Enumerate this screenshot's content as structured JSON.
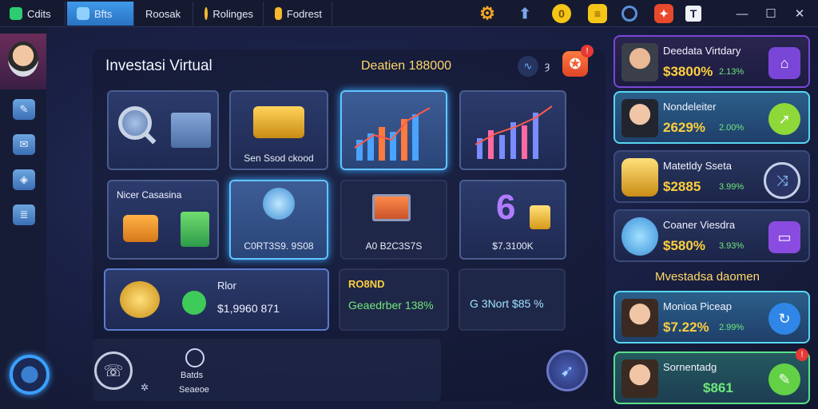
{
  "tabs": [
    {
      "label": "Cdits",
      "active": false
    },
    {
      "label": "Bfts",
      "active": true
    },
    {
      "label": "Roosak",
      "active": false
    },
    {
      "label": "Rolinges",
      "active": false
    },
    {
      "label": "Fodrest",
      "active": false
    }
  ],
  "toolbar_icons": [
    "gear-icon",
    "up-arrow-icon",
    "coin-icon",
    "note-icon",
    "ring-icon",
    "dice-icon",
    "t-box-icon"
  ],
  "window_controls": {
    "minimize": "—",
    "maximize": "☐",
    "close": "✕"
  },
  "header": {
    "title": "Investasi Virtual",
    "balance": "Deatien 188000",
    "extra_icon_text": "ȝ",
    "notification_badge": "!"
  },
  "cards": [
    {
      "label": ""
    },
    {
      "label": "Sen Ssod ckood"
    },
    {
      "label": ""
    },
    {
      "label": ""
    },
    {
      "label": "Nicer Casasina"
    },
    {
      "label": "C0RT3S9. 9S08"
    },
    {
      "label": "A0 B2C3S7S"
    },
    {
      "label": "$7.3100K"
    }
  ],
  "bottom_cards": {
    "left": {
      "title": "Rlor",
      "value": "$1,9960 871"
    },
    "middle": {
      "title": "RO8ND",
      "value": "Geaedrber 138%"
    },
    "right": {
      "value": "G 3Nort $85 %"
    }
  },
  "bottom_bar": {
    "center_label_1": "Batds",
    "center_label_2": "Seaeoe"
  },
  "right_list": {
    "section_heading": "Mvestadsa daomen",
    "items": [
      {
        "title": "Deedata Virtdary",
        "value": "$3800%",
        "pct": "2.13%",
        "style": "purple",
        "action_icon": "home-icon"
      },
      {
        "title": "Nondeleiter",
        "value": "2629%",
        "pct": "2.00%",
        "style": "cyan",
        "action_icon": "arrow-icon"
      },
      {
        "title": "Matetldy Sseta",
        "value": "$2885",
        "pct": "3.99%",
        "style": "plain",
        "action_icon": "share-icon"
      },
      {
        "title": "Coaner Viesdra",
        "value": "$580%",
        "pct": "3.93%",
        "style": "plain",
        "action_icon": "card-icon"
      },
      {
        "title": "Monioa Piceap",
        "value": "$7.22%",
        "pct": "2.99%",
        "style": "cyan",
        "action_icon": "refresh-icon"
      },
      {
        "title": "Sornentadg",
        "value": "$861",
        "pct": "",
        "style": "green",
        "action_icon": "leaf-icon"
      }
    ]
  },
  "colors": {
    "accent": "#3aa6ff",
    "gold": "#ffcf3d",
    "green": "#6fe87c",
    "purple": "#7a46d8"
  }
}
